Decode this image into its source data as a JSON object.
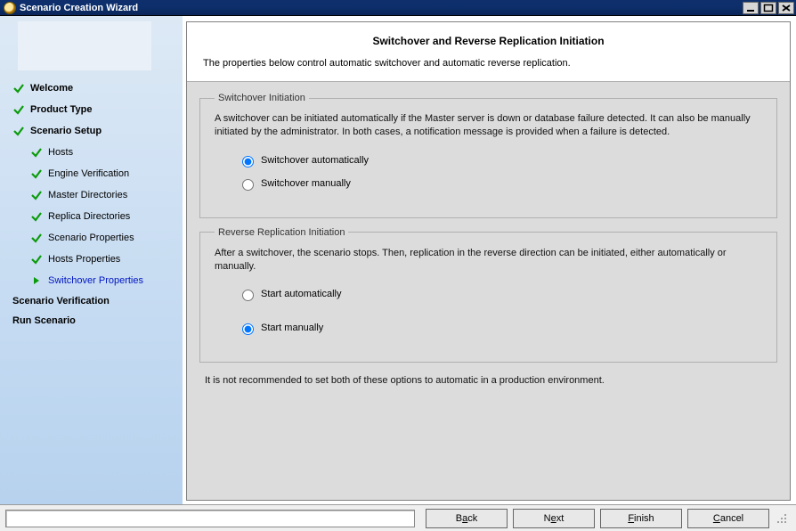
{
  "window": {
    "title": "Scenario Creation Wizard"
  },
  "sidebar": {
    "items": [
      {
        "label": "Welcome",
        "icon": "check",
        "bold": true
      },
      {
        "label": "Product Type",
        "icon": "check",
        "bold": true
      },
      {
        "label": "Scenario Setup",
        "icon": "check",
        "bold": true
      },
      {
        "label": "Hosts",
        "icon": "check",
        "sub": true
      },
      {
        "label": "Engine Verification",
        "icon": "check",
        "sub": true
      },
      {
        "label": "Master Directories",
        "icon": "check",
        "sub": true
      },
      {
        "label": "Replica Directories",
        "icon": "check",
        "sub": true
      },
      {
        "label": "Scenario Properties",
        "icon": "check",
        "sub": true
      },
      {
        "label": "Hosts Properties",
        "icon": "check",
        "sub": true
      },
      {
        "label": "Switchover Properties",
        "icon": "arrow",
        "sub": true,
        "current": true
      },
      {
        "label": "Scenario Verification",
        "icon": "none",
        "bold": true
      },
      {
        "label": "Run Scenario",
        "icon": "none",
        "bold": true
      }
    ]
  },
  "page": {
    "title": "Switchover and Reverse Replication Initiation",
    "description": "The properties below control automatic switchover and automatic reverse replication."
  },
  "switchover": {
    "legend": "Switchover Initiation",
    "description": "A switchover can be initiated automatically if the Master server is down or database failure detected. It can also be manually initiated by the administrator. In both cases, a notification message is provided when a failure is detected.",
    "option_auto": "Switchover automatically",
    "option_manual": "Switchover manually",
    "selected": "auto"
  },
  "reverse": {
    "legend": "Reverse Replication Initiation",
    "description": "After a switchover, the scenario stops. Then, replication in the reverse direction can be initiated, either automatically or manually.",
    "option_auto": "Start automatically",
    "option_manual": "Start manually",
    "selected": "manual"
  },
  "note": "It is not recommended to set both of these options to automatic in a production environment.",
  "footer": {
    "back_pre": "B",
    "back_mnemonic": "a",
    "back_post": "ck",
    "next_pre": "N",
    "next_mnemonic": "e",
    "next_post": "xt",
    "finish_pre": "",
    "finish_mnemonic": "F",
    "finish_post": "inish",
    "cancel_pre": "",
    "cancel_mnemonic": "C",
    "cancel_post": "ancel"
  }
}
